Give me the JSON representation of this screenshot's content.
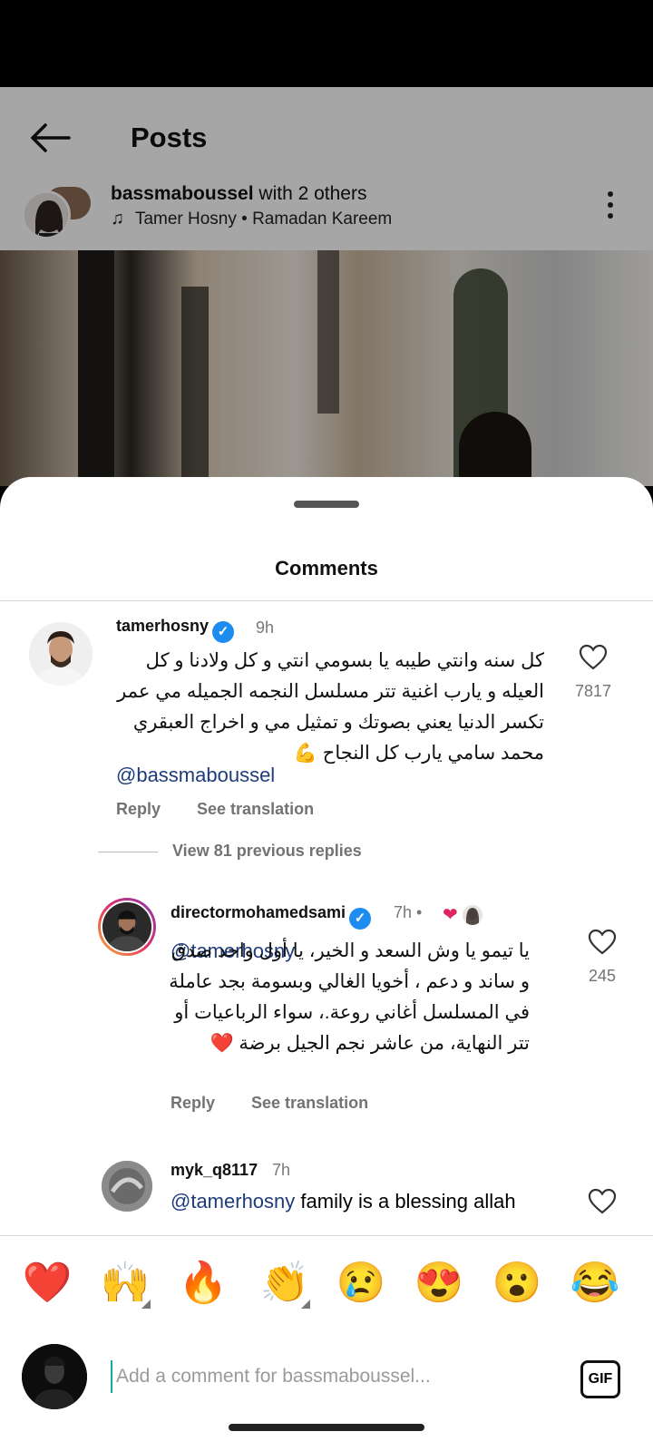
{
  "header": {
    "title": "Posts"
  },
  "post": {
    "author": "bassmaboussel",
    "author_suffix": "with 2 others",
    "music": "Tamer Hosny • Ramadan Kareem"
  },
  "sheet": {
    "title": "Comments"
  },
  "comments": [
    {
      "username": "tamerhosny",
      "time": "9h",
      "text": "كل سنه وانتي طيبه يا بسومي انتي و كل ولادنا و كل العيله  و يارب اغنية تتر مسلسل النجمه الجميله مي عمر تكسر الدنيا  يعني بصوتك و تمثيل مي و اخراج العبقري محمد سامي  يارب كل النجاح 💪",
      "mention": "@bassmaboussel",
      "likes": "7817",
      "reply_label": "Reply",
      "translate_label": "See translation"
    },
    {
      "username": "directormohamedsami",
      "time": "7h •",
      "mention": "@tamerhosny",
      "text": "يا تيمو يا وش السعد و الخير، يا أول واحد صدق و ساند و دعم ، أخويا الغالي وبسومة بجد عاملة في المسلسل أغاني روعة.، سواء الرباعيات أو تتر النهاية، من عاشر نجم الجيل برضة ❤️",
      "likes": "245",
      "reply_label": "Reply",
      "translate_label": "See translation"
    },
    {
      "username": "myk_q8117",
      "time": "7h",
      "mention": "@tamerhosny",
      "text": "family is a blessing allah"
    }
  ],
  "view_replies": "View 81 previous replies",
  "emojis": [
    "❤️",
    "🙌",
    "🔥",
    "👏",
    "😢",
    "😍",
    "😮",
    "😂"
  ],
  "composer": {
    "placeholder": "Add a comment for bassmaboussel...",
    "gif_label": "GIF"
  },
  "colors": {
    "verified": "#1d8cf0",
    "mention": "#1f3c7a",
    "muted": "#737373"
  }
}
